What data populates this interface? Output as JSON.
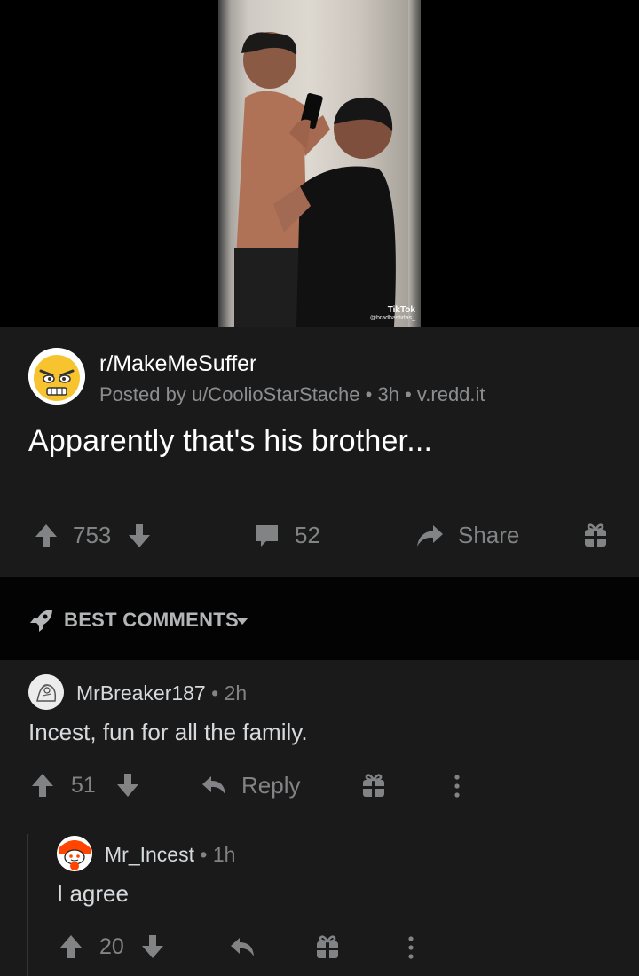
{
  "video": {
    "watermark_logo": "TikTok",
    "watermark_handle": "@bradbastidas_"
  },
  "post": {
    "subreddit": "r/MakeMeSuffer",
    "posted_by": "Posted by u/CoolioStarStache",
    "age": "3h",
    "domain": "v.redd.it",
    "title": "Apparently that's his brother...",
    "votes": "753",
    "comments_count": "52",
    "share_label": "Share"
  },
  "sort": {
    "label": "BEST COMMENTS"
  },
  "comments": [
    {
      "author": "MrBreaker187",
      "age": "2h",
      "body": "Incest, fun for all the family.",
      "votes": "51",
      "reply_label": "Reply"
    },
    {
      "author": "Mr_Incest",
      "age": "1h",
      "body": "I agree",
      "votes": "20"
    }
  ],
  "colors": {
    "background": "#000000",
    "card": "#1a1a1b",
    "text": "#d7dadc",
    "muted": "#818384",
    "accent": "#ff4500"
  },
  "icons": [
    "upvote-icon",
    "downvote-icon",
    "comment-icon",
    "share-icon",
    "award-icon",
    "rocket-icon",
    "chevron-down-icon",
    "reply-icon",
    "more-icon"
  ]
}
